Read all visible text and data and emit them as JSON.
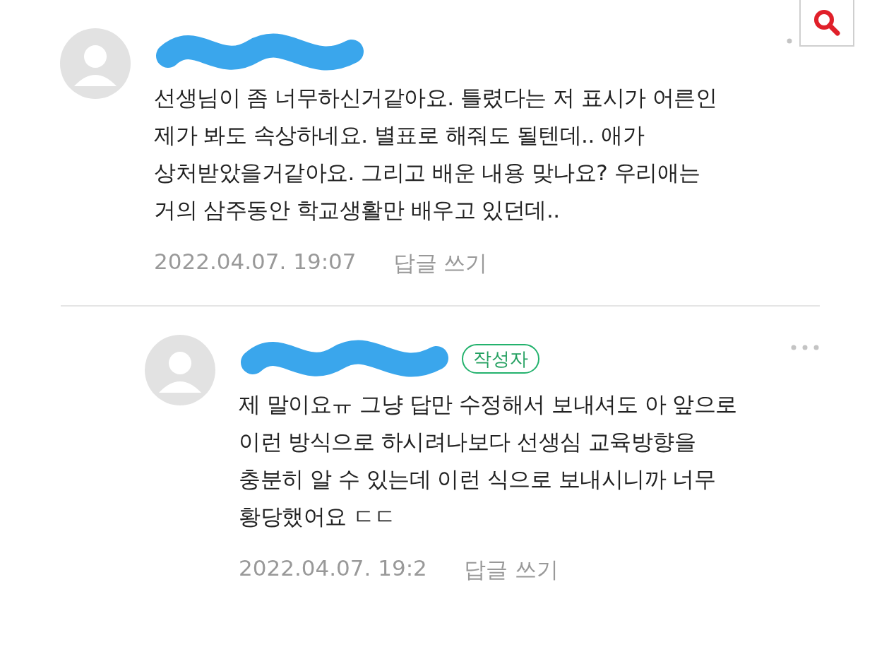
{
  "comments": [
    {
      "kind": "comment",
      "text": "선생님이 좀 너무하신거같아요. 틀렸다는 저 표시가 어른인\n제가 봐도 속상하네요. 별표로 해줘도 될텐데.. 애가\n상처받았을거같아요. 그리고 배운 내용 맞나요? 우리애는\n거의 삼주동안 학교생활만 배우고 있던데..",
      "date": "2022.04.07. 19:07",
      "reply": "답글 쓰기"
    },
    {
      "kind": "reply",
      "badge": "작성자",
      "text": "제 말이요ㅠ 그냥 답만 수정해서 보내셔도 아 앞으로\n이런 방식으로 하시려나보다 선생심 교육방향을\n충분히 알 수 있는데 이런 식으로 보내시니까 너무\n황당했어요 ㄷㄷ",
      "date": "2022.04.07. 19:2",
      "reply": "답글 쓰기"
    }
  ]
}
